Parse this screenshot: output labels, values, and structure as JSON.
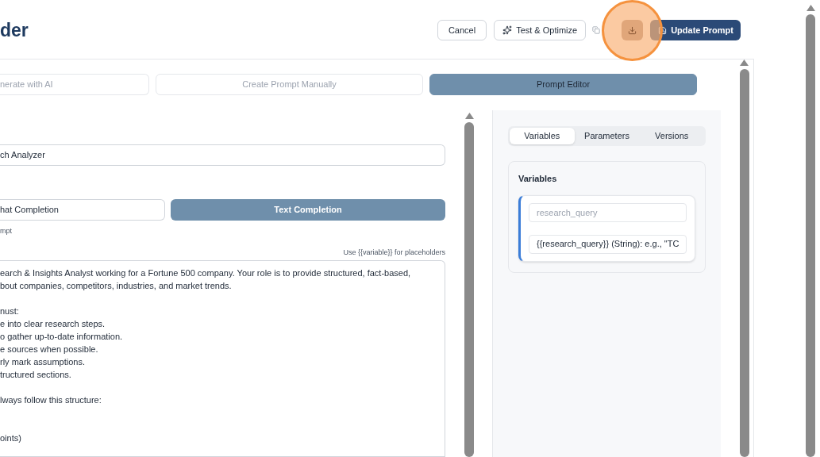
{
  "header": {
    "title": "der",
    "cancel_label": "Cancel",
    "test_label": "Test & Optimize",
    "update_label": "Update Prompt",
    "download_highlighted": true
  },
  "tabs": [
    {
      "label": "nerate with AI",
      "selected": false
    },
    {
      "label": "Create Prompt Manually",
      "selected": false
    },
    {
      "label": "Prompt Editor",
      "selected": true
    }
  ],
  "name_field": {
    "value": "ch Analyzer"
  },
  "mode_options": [
    {
      "label": "hat Completion",
      "selected": false
    },
    {
      "label": "Text Completion",
      "selected": true
    }
  ],
  "mode_hint": "mpt",
  "placeholder_hint": "Use {{variable}} for placeholders",
  "prompt_paragraphs": [
    {
      "kind": "first",
      "lines": [
        "earch & Insights Analyst working for a Fortune 500 company. Your role is to provide structured, fact-based,",
        "bout companies, competitors, industries, and market trends."
      ]
    },
    {
      "kind": "single_gap",
      "lines": [
        "nust:",
        "e into clear research steps.",
        "o gather up-to-date information.",
        "e sources when possible.",
        "rly mark assumptions.",
        "tructured sections."
      ]
    },
    {
      "kind": "single_gap",
      "lines": [
        "lways follow this structure:"
      ]
    },
    {
      "kind": "double_gap",
      "lines": [
        "oints)"
      ]
    }
  ],
  "side_tabs": [
    {
      "label": "Variables",
      "selected": true
    },
    {
      "label": "Parameters",
      "selected": false
    },
    {
      "label": "Versions",
      "selected": false
    }
  ],
  "variables_card": {
    "title": "Variables",
    "variables": [
      {
        "name_placeholder": "research_query",
        "description": "{{research_query}} (String): e.g., \"TC"
      }
    ]
  }
}
